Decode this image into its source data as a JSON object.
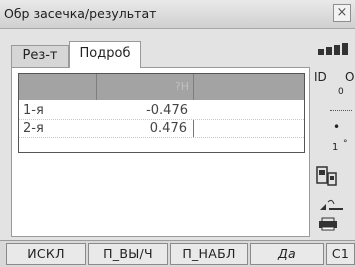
{
  "window": {
    "title": "Обр засечка/результат",
    "close_label": "×"
  },
  "tabs": [
    {
      "label": "Рез-т",
      "active": false
    },
    {
      "label": "Подроб",
      "active": true
    }
  ],
  "table": {
    "columns": [
      "",
      "?H",
      ""
    ],
    "rows": [
      {
        "name": "1-я",
        "value": "-0.476"
      },
      {
        "name": "2-я",
        "value": "0.476"
      }
    ]
  },
  "sidebar": {
    "id_label": "ID",
    "o_label": "O",
    "zero_label": "0",
    "one_label": "1",
    "deg_label": "°",
    "icons": [
      "battery-icon",
      "level-dial-icon",
      "prism-icon",
      "laser-icon",
      "printer-icon"
    ]
  },
  "fkeys": [
    "ИСКЛ",
    "П_ВЫ/Ч",
    "П_НАБЛ",
    "Да",
    "С1"
  ],
  "colors": {
    "header_bg": "#a3a3a3",
    "panel_bg": "#ffffff",
    "window_bg": "#e3e3e3"
  }
}
